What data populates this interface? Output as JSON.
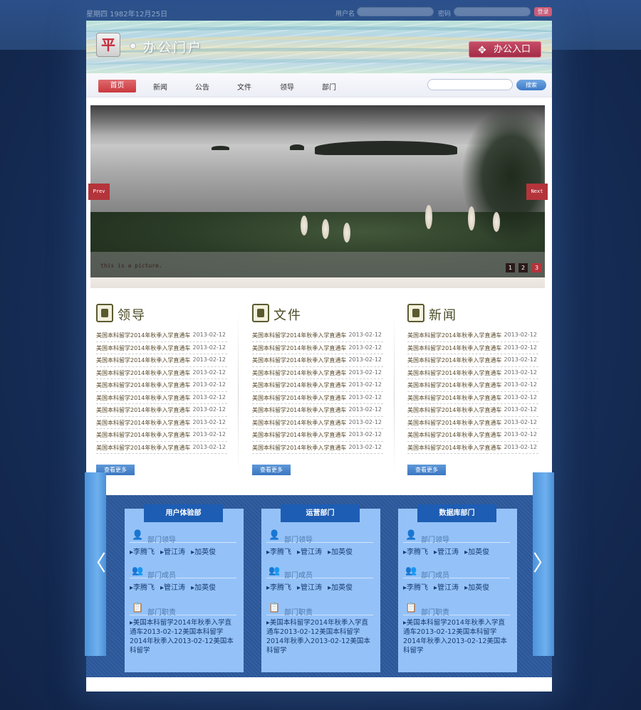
{
  "topbar": {
    "date": "星期四  1982年12月25日",
    "username_label": "用户名",
    "password_label": "密码",
    "login_label": "登录"
  },
  "header": {
    "logo_text": "办公门户",
    "office_entry_label": "办公入口"
  },
  "nav": {
    "items": [
      "首页",
      "新闻",
      "公告",
      "文件",
      "领导",
      "部门"
    ],
    "active_index": 0,
    "search_label": "搜索"
  },
  "slider": {
    "caption": "this is a picture.",
    "prev_label": "Prev",
    "next_label": "Next",
    "pages": [
      "1",
      "2",
      "3"
    ],
    "active_page": 3
  },
  "columns": [
    {
      "title": "领导",
      "icon": "leader-icon",
      "items": [
        {
          "title": "美国本科留学2014年秋季入学直通车",
          "date": "2013-02-12"
        },
        {
          "title": "美国本科留学2014年秋季入学直通车",
          "date": "2013-02-12"
        },
        {
          "title": "美国本科留学2014年秋季入学直通车",
          "date": "2013-02-12"
        },
        {
          "title": "美国本科留学2014年秋季入学直通车",
          "date": "2013-02-12"
        },
        {
          "title": "美国本科留学2014年秋季入学直通车",
          "date": "2013-02-12"
        },
        {
          "title": "美国本科留学2014年秋季入学直通车",
          "date": "2013-02-12"
        },
        {
          "title": "美国本科留学2014年秋季入学直通车",
          "date": "2013-02-12"
        },
        {
          "title": "美国本科留学2014年秋季入学直通车",
          "date": "2013-02-12"
        },
        {
          "title": "美国本科留学2014年秋季入学直通车",
          "date": "2013-02-12"
        },
        {
          "title": "美国本科留学2014年秋季入学直通车",
          "date": "2013-02-12"
        }
      ],
      "more_label": "查看更多"
    },
    {
      "title": "文件",
      "icon": "document-icon",
      "items": [
        {
          "title": "美国本科留学2014年秋季入学直通车",
          "date": "2013-02-12"
        },
        {
          "title": "美国本科留学2014年秋季入学直通车",
          "date": "2013-02-12"
        },
        {
          "title": "美国本科留学2014年秋季入学直通车",
          "date": "2013-02-12"
        },
        {
          "title": "美国本科留学2014年秋季入学直通车",
          "date": "2013-02-12"
        },
        {
          "title": "美国本科留学2014年秋季入学直通车",
          "date": "2013-02-12"
        },
        {
          "title": "美国本科留学2014年秋季入学直通车",
          "date": "2013-02-12"
        },
        {
          "title": "美国本科留学2014年秋季入学直通车",
          "date": "2013-02-12"
        },
        {
          "title": "美国本科留学2014年秋季入学直通车",
          "date": "2013-02-12"
        },
        {
          "title": "美国本科留学2014年秋季入学直通车",
          "date": "2013-02-12"
        },
        {
          "title": "美国本科留学2014年秋季入学直通车",
          "date": "2013-02-12"
        }
      ],
      "more_label": "查看更多"
    },
    {
      "title": "新闻",
      "icon": "newspaper-icon",
      "items": [
        {
          "title": "美国本科留学2014年秋季入学直通车",
          "date": "2013-02-12"
        },
        {
          "title": "美国本科留学2014年秋季入学直通车",
          "date": "2013-02-12"
        },
        {
          "title": "美国本科留学2014年秋季入学直通车",
          "date": "2013-02-12"
        },
        {
          "title": "美国本科留学2014年秋季入学直通车",
          "date": "2013-02-12"
        },
        {
          "title": "美国本科留学2014年秋季入学直通车",
          "date": "2013-02-12"
        },
        {
          "title": "美国本科留学2014年秋季入学直通车",
          "date": "2013-02-12"
        },
        {
          "title": "美国本科留学2014年秋季入学直通车",
          "date": "2013-02-12"
        },
        {
          "title": "美国本科留学2014年秋季入学直通车",
          "date": "2013-02-12"
        },
        {
          "title": "美国本科留学2014年秋季入学直通车",
          "date": "2013-02-12"
        },
        {
          "title": "美国本科留学2014年秋季入学直通车",
          "date": "2013-02-12"
        }
      ],
      "more_label": "查看更多"
    }
  ],
  "departments": {
    "prev_arrow": "〈",
    "next_arrow": "〉",
    "cards": [
      {
        "name": "用户体验部",
        "leader_label": "部门领导",
        "leaders": [
          "▸李腾飞",
          "▸管江涛",
          "▸加英俊"
        ],
        "member_label": "部门成员",
        "members": [
          "▸李腾飞",
          "▸管江涛",
          "▸加英俊"
        ],
        "duty_label": "部门职责",
        "duty_text": "▸美国本科留学2014年秋季入学直通车2013-02-12美国本科留学2014年秋季入2013-02-12美国本科留学"
      },
      {
        "name": "运营部门",
        "leader_label": "部门领导",
        "leaders": [
          "▸李腾飞",
          "▸管江涛",
          "▸加英俊"
        ],
        "member_label": "部门成员",
        "members": [
          "▸李腾飞",
          "▸管江涛",
          "▸加英俊"
        ],
        "duty_label": "部门职责",
        "duty_text": "▸美国本科留学2014年秋季入学直通车2013-02-12美国本科留学2014年秋季入2013-02-12美国本科留学"
      },
      {
        "name": "数据库部门",
        "leader_label": "部门领导",
        "leaders": [
          "▸李腾飞",
          "▸管江涛",
          "▸加英俊"
        ],
        "member_label": "部门成员",
        "members": [
          "▸李腾飞",
          "▸管江涛",
          "▸加英俊"
        ],
        "duty_label": "部门职责",
        "duty_text": "▸美国本科留学2014年秋季入学直通车2013-02-12美国本科留学2014年秋季入2013-02-12美国本科留学"
      }
    ]
  }
}
